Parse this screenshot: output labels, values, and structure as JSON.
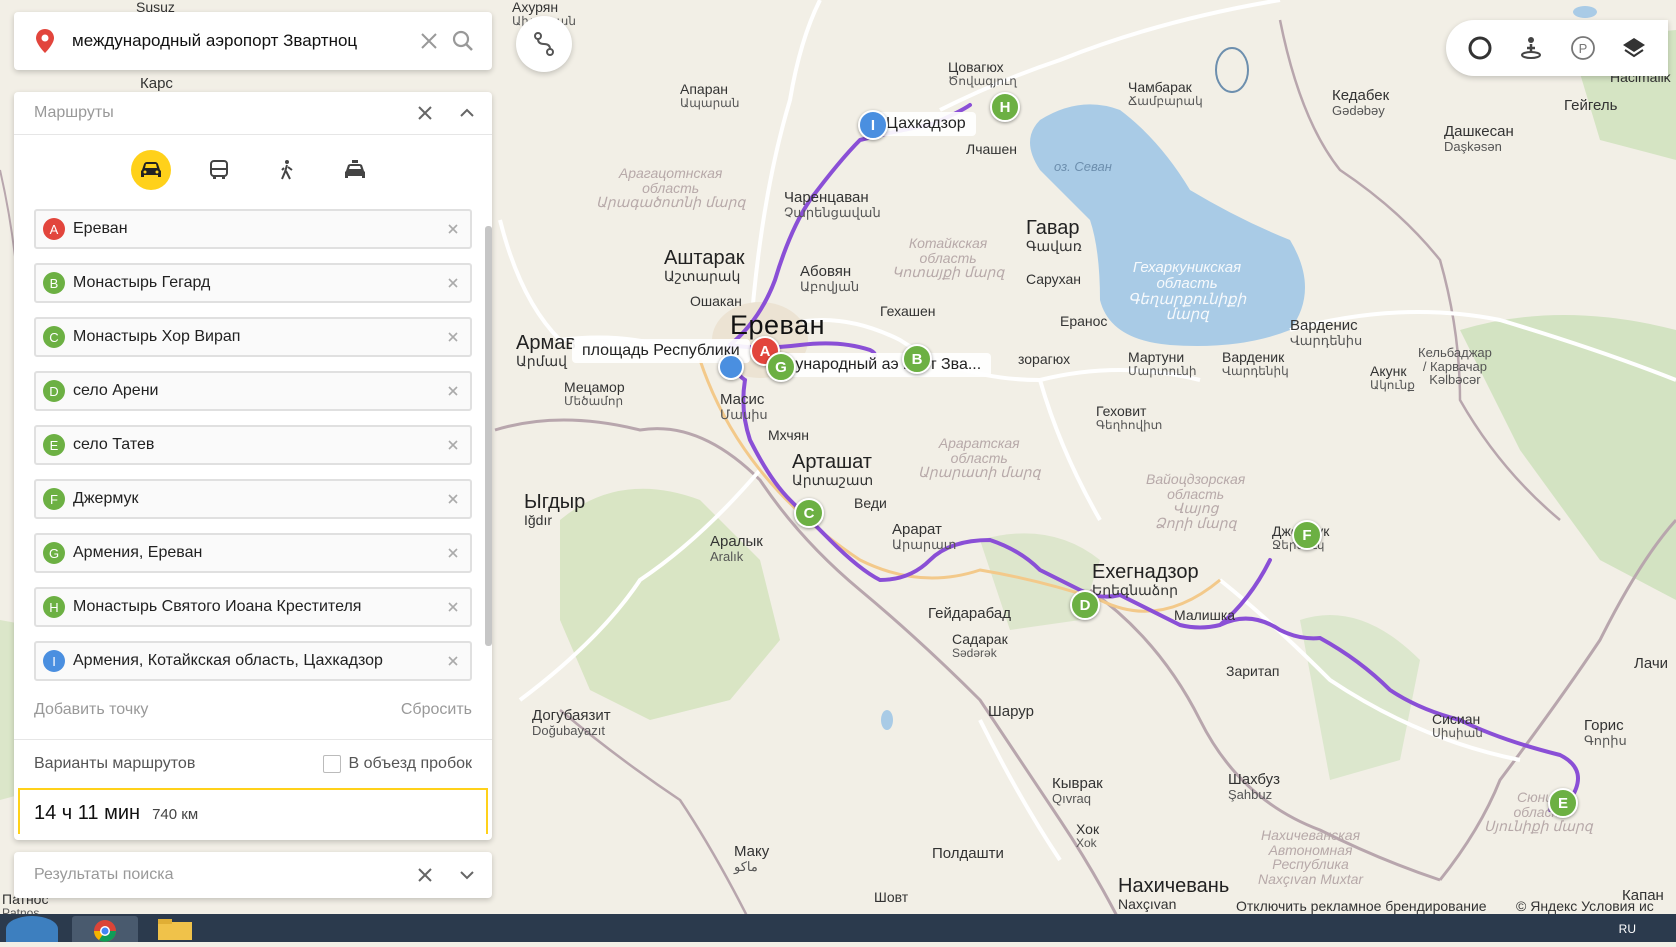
{
  "search": {
    "query": "международный аэропорт Звартноц"
  },
  "routes_panel": {
    "title": "Маршруты",
    "transport_modes": [
      "car",
      "bus",
      "pedestrian",
      "taxi"
    ],
    "active_mode": "car",
    "waypoints": [
      {
        "letter": "A",
        "name": "Ереван",
        "color": "#e2453c"
      },
      {
        "letter": "B",
        "name": "Монастырь Гегард",
        "color": "#6cb043"
      },
      {
        "letter": "C",
        "name": "Монастырь Хор Вирап",
        "color": "#6cb043"
      },
      {
        "letter": "D",
        "name": "село Арени",
        "color": "#6cb043"
      },
      {
        "letter": "E",
        "name": "село Татев",
        "color": "#6cb043"
      },
      {
        "letter": "F",
        "name": "Джермук",
        "color": "#6cb043"
      },
      {
        "letter": "G",
        "name": "Армения, Ереван",
        "color": "#6cb043"
      },
      {
        "letter": "H",
        "name": "Монастырь Святого Иоана Крестителя",
        "color": "#6cb043"
      },
      {
        "letter": "I",
        "name": "Армения, Котайкская область, Цахкадзор",
        "color": "#4a8fe0"
      }
    ],
    "add_point": "Добавить точку",
    "reset": "Сбросить",
    "route_options": "Варианты маршрутов",
    "avoid_traffic": "В объезд пробок",
    "route_time": "14 ч 11 мин",
    "route_distance": "740 км"
  },
  "results_panel": {
    "title": "Результаты поиска"
  },
  "map": {
    "accent": "#8a4fd6",
    "lake": {
      "name": "оз. Севан"
    },
    "bubbles": {
      "tsakhkadzor": "Цахкадзор",
      "square": "площадь Республики",
      "airport": "дународный аэ  порт Зва..."
    },
    "pins": {
      "A": "A",
      "B": "B",
      "C": "C",
      "D": "D",
      "E": "E",
      "F": "F",
      "G": "G",
      "H": "H",
      "I": "I"
    },
    "labels": {
      "yerevan": "Ереван",
      "ashtarak": "Аштарак",
      "ashtarak_am": "Աշտարակ",
      "armavir": "Армав",
      "armavir_am": "Արմավ",
      "charentsavan": "Чаренцаван",
      "charentsavan_am": "Չարենցավան",
      "abovyan": "Абовян",
      "abovyan_am": "Աբովյան",
      "gavar": "Гавар",
      "gavar_am": "Գավառ",
      "masis": "Масис",
      "masis_am": "Մասիս",
      "artashat": "Арташат",
      "artashat_am": "Արտաշատ",
      "ararat": "Арарат",
      "ararat_am": "Արարատ",
      "yeghegnadzor": "Ехегнадзор",
      "yeghegnadzor_am": "Եղեգնաձոր",
      "igdir": "Ыгдыр",
      "igdir_tr": "Iğdır",
      "aralik": "Аралык",
      "aralik_tr": "Aralık",
      "kedabek": "Кедабек",
      "kedabek_az": "Gədəbəy",
      "dashkesan": "Дашкесан",
      "dashkesan_az": "Daşkəsən",
      "geygel": "Гейгель",
      "hacimalik": "Hacimalik",
      "vardenis": "Варденис",
      "vardenis_am": "Վարդենիս",
      "kelbajar": "Кельбаджар",
      "kelbajar2": "/ Карвачар",
      "kelbajar_az": "Kəlbəcər",
      "goris": "Горис",
      "goris_am": "Գորիս",
      "shakhbuz": "Шахбуз",
      "shakhbuz_az": "Şahbuz",
      "kyvrag": "Кыврак",
      "kyvrag_az": "Qıvraq",
      "nakhchivan": "Нахичевань",
      "nakhchivan_az": "Naxçıvan",
      "dogubayazit": "Догубаязит",
      "dogubayazit_tr": "Doğubayazıt",
      "maku": "Маку",
      "maku_fa": "ماکو",
      "sharur": "Шарур",
      "poldashti": "Полдашти",
      "gejdarabad": "Гейдарабад",
      "sadarak": "Садарак",
      "sadarak_az": "Sədərək",
      "zaritap": "Заритап",
      "malishka": "Малишка",
      "sisian": "Сисиан",
      "sisian_am": "Սիսիան",
      "dzhermuk": "Джермук",
      "dzhermuk_am": "Ջերմուկ",
      "sevan": "Севан",
      "tsovagyugh": "Цовагюх",
      "tsovagyugh_am": "Ծովագյուղ",
      "lchashen": "Лчашен",
      "sarukhan": "Сарухан",
      "yeranos": "Еранос",
      "martuni": "Мартуни",
      "martuni_am": "Մարտունի",
      "vardenik": "Варденик",
      "vardenik_am": "Վարդենիկ",
      "akunk": "Акунк",
      "akunk_am": "Ակունք",
      "gekhovit": "Геховит",
      "gekhovit_am": "Գեղհովիտ",
      "geghashen": "Гехашен",
      "oshakan": "Ошакан",
      "metsamor": "Мецамор",
      "metsamor_am": "Մեծամոր",
      "mkhchyan": "Мхчян",
      "vedi": "Веди",
      "apar": "Апаран",
      "apar_am": "Ապարան",
      "chambarak": "Чамбарак",
      "chambarak_am": "Ճամբարակ",
      "khok": "Хок",
      "khok_az": "Xok",
      "shovt": "Шовт",
      "kapan": "Капан",
      "lachin": "Лачи",
      "kars": "Карс",
      "susuz": "Susuz",
      "akhuryan": "Ахурян",
      "akhuryan_am": "Ախուրյան",
      "zoraghyugh": "зорагюх",
      "patnos": "Патнос",
      "patnos_tr": "Patnos",
      "aragats_region": "Арагацотнская",
      "aragats_region2": "область",
      "aragats_region_am": "Արագածոտնի մարզ",
      "kotayk_region": "Котайкская",
      "kotayk_region2": "область",
      "kotayk_region_am": "Կոտայքի մարզ",
      "ararat_region": "Араратская",
      "ararat_region2": "область",
      "ararat_region_am": "Արարատի մարզ",
      "vayots_region": "Вайоцдзорская",
      "vayots_region2": "область",
      "vayots_region_am": "Վայոց",
      "vayots_region_am2": "Ձորի մարզ",
      "gegharkunik_region": "Гехаркуникская",
      "gegharkunik_region2": "область",
      "gegharkunik_region_am": "Գեղարքունիքի",
      "gegharkunik_region_am2": "մարզ",
      "syunik_region": "Сюник",
      "syunik_region2": "област",
      "syunik_region_am": "Սյունիքի մարզ",
      "nakh_region": "Нахичеванская",
      "nakh_region2": "Автономная",
      "nakh_region3": "Республика",
      "nakh_region4": "Naxçıvan Muxtar"
    }
  },
  "footer": {
    "disable_branding": "Отключить рекламное брендирование",
    "copyright": "© Яндекс Условия ис"
  },
  "taskbar": {
    "lang": "RU"
  }
}
